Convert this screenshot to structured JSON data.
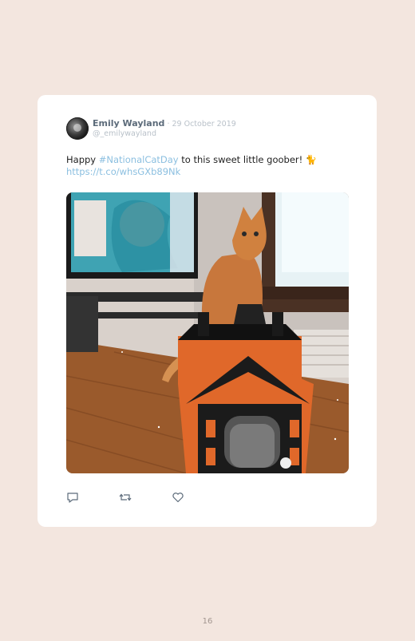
{
  "tweet": {
    "author_name": "Emily Wayland",
    "date": " · 29 October 2019",
    "handle": "@_emilywayland",
    "text_before": "Happy ",
    "hashtag": "#NationalCatDay",
    "text_after": " to this sweet little goober! 🐈",
    "link": "https://t.co/whsGXb89Nk",
    "image_icon": "cat-photo-halloween-house"
  },
  "actions": {
    "reply_icon": "reply-icon",
    "retweet_icon": "retweet-icon",
    "like_icon": "heart-icon"
  },
  "page_number": "16",
  "colors": {
    "background": "#f3e6df",
    "card": "#ffffff",
    "name": "#5c6b7a",
    "meta": "#b9c1c9",
    "link": "#8bbfe0"
  }
}
